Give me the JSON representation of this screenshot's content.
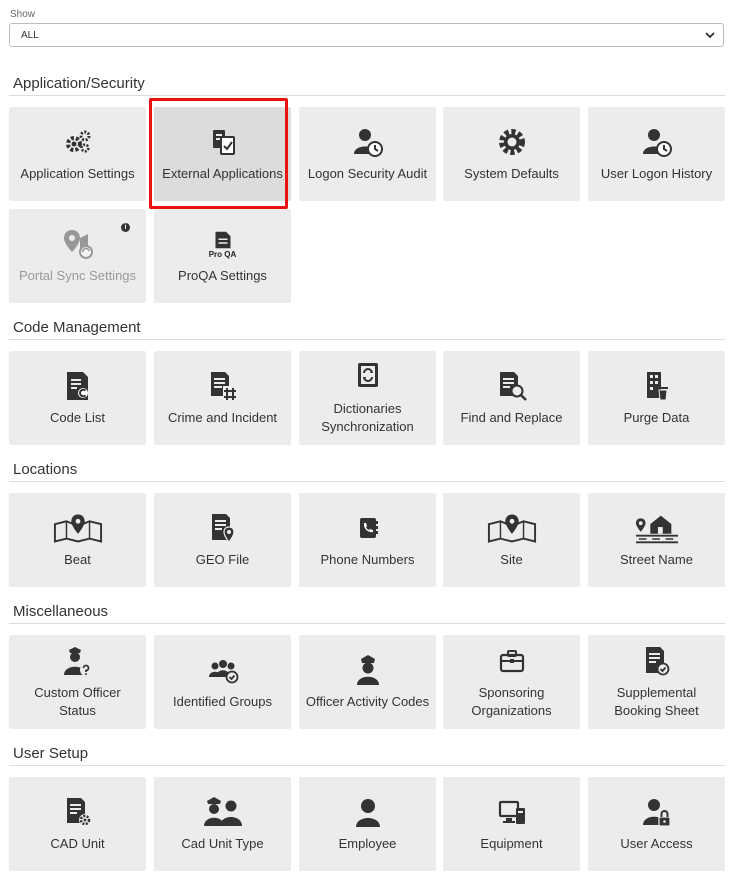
{
  "filter": {
    "label": "Show",
    "value": "ALL"
  },
  "sections": [
    {
      "title": "Application/Security",
      "tiles": [
        "Application Settings",
        "External Applications",
        "Logon Security Audit",
        "System Defaults",
        "User Logon History",
        "Portal Sync Settings",
        "ProQA Settings"
      ]
    },
    {
      "title": "Code Management",
      "tiles": [
        "Code List",
        "Crime and Incident",
        "Dictionaries Synchronization",
        "Find and Replace",
        "Purge Data"
      ]
    },
    {
      "title": "Locations",
      "tiles": [
        "Beat",
        "GEO File",
        "Phone Numbers",
        "Site",
        "Street Name"
      ]
    },
    {
      "title": "Miscellaneous",
      "tiles": [
        "Custom Officer Status",
        "Identified Groups",
        "Officer Activity Codes",
        "Sponsoring Organizations",
        "Supplemental Booking Sheet"
      ]
    },
    {
      "title": "User Setup",
      "tiles": [
        "CAD Unit",
        "Cad Unit Type",
        "Employee",
        "Equipment",
        "User Access"
      ]
    }
  ],
  "proqa_icon_text": "Pro QA",
  "info_badge": "i",
  "icons": {
    "app_settings": "gears-icon",
    "external_apps": "clipboard-check-icon",
    "logon_audit": "user-clock-icon",
    "system_defaults": "gear-icon",
    "user_logon_history": "user-clock-icon",
    "portal_sync": "map-sync-icon",
    "proqa": "proqa-document-icon",
    "code_list": "document-c-icon",
    "crime_incident": "document-hash-icon",
    "dictionaries": "book-sync-icon",
    "find_replace": "document-search-icon",
    "purge": "building-trash-icon",
    "beat": "map-pin-icon",
    "geo_file": "document-pin-icon",
    "phone_numbers": "phone-book-icon",
    "site": "map-pin-icon",
    "street_name": "house-road-icon",
    "custom_officer": "officer-question-icon",
    "identified_groups": "group-check-icon",
    "officer_activity": "officer-icon",
    "sponsoring": "briefcase-icon",
    "supplemental": "document-check-icon",
    "cad_unit": "document-gear-icon",
    "cad_unit_type": "officers-icon",
    "employee": "user-icon",
    "equipment": "computer-icon",
    "user_access": "user-lock-icon"
  }
}
